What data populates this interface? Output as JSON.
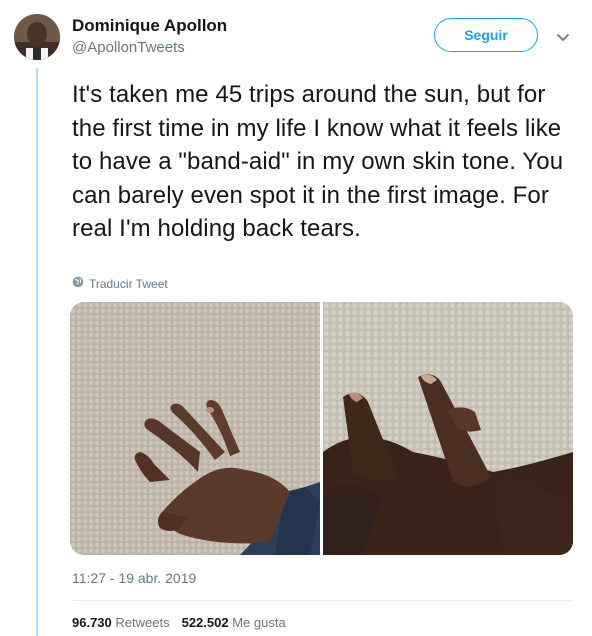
{
  "author": {
    "display_name": "Dominique Apollon",
    "handle": "@ApollonTweets"
  },
  "follow_label": "Seguir",
  "tweet_text": "It's taken me 45 trips around the sun, but for the first time in my life I know what it feels like to have a \"band-aid\" in my own skin tone. You can barely even spot it in the first image. For real I'm holding back tears.",
  "translate_label": "Traducir Tweet",
  "timestamp": "11:27 - 19 abr. 2019",
  "stats": {
    "retweets_count": "96.730",
    "retweets_label": "Retweets",
    "likes_count": "522.502",
    "likes_label": "Me gusta"
  },
  "icons": {
    "more": "chevron-down-icon",
    "translate": "globe-icon"
  },
  "colors": {
    "accent": "#1da1f2",
    "thread_line": "#aee0f9",
    "secondary_text": "#657786"
  }
}
